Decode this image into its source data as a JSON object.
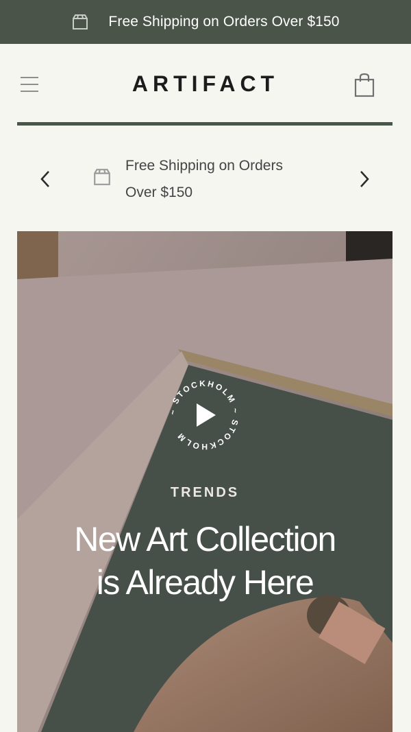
{
  "announcement": {
    "text": "Free Shipping on Orders Over $150",
    "icon": "box-icon"
  },
  "header": {
    "logo": "ARTIFACT",
    "menu_icon": "hamburger-menu-icon",
    "cart_icon": "shopping-bag-icon",
    "accent_color": "#4a5449"
  },
  "promo_slider": {
    "line1": "Free Shipping on Orders",
    "line2": "Over $150",
    "icon": "box-icon",
    "prev_icon": "chevron-left-icon",
    "next_icon": "chevron-right-icon"
  },
  "hero": {
    "badge_text": "~ STOCKHOLM ~ STOCKHOLM ",
    "eyebrow": "TRENDS",
    "title_line1": "New Art Collection",
    "title_line2": "is Already Here",
    "play_icon": "play-icon"
  }
}
